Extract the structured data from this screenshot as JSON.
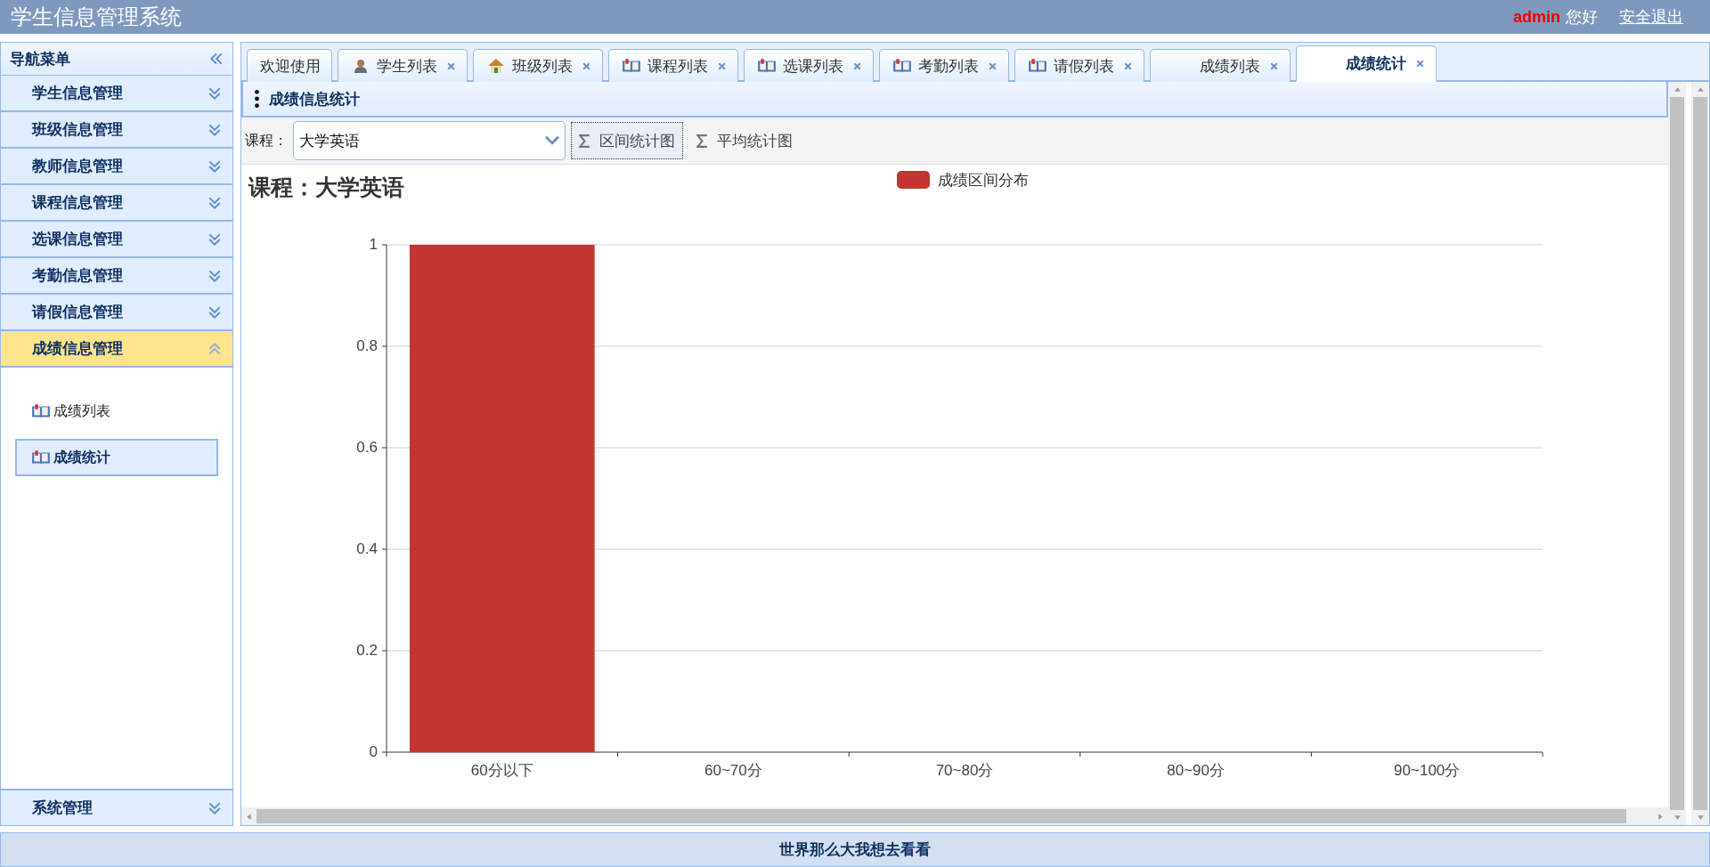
{
  "header": {
    "title": "学生信息管理系统",
    "user": "admin",
    "greeting": "您好",
    "logout": "安全退出"
  },
  "sidebar": {
    "title": "导航菜单",
    "items": [
      {
        "label": "学生信息管理",
        "expanded": false
      },
      {
        "label": "班级信息管理",
        "expanded": false
      },
      {
        "label": "教师信息管理",
        "expanded": false
      },
      {
        "label": "课程信息管理",
        "expanded": false
      },
      {
        "label": "选课信息管理",
        "expanded": false
      },
      {
        "label": "考勤信息管理",
        "expanded": false
      },
      {
        "label": "请假信息管理",
        "expanded": false
      },
      {
        "label": "成绩信息管理",
        "expanded": true,
        "children": [
          {
            "label": "成绩列表",
            "selected": false
          },
          {
            "label": "成绩统计",
            "selected": true
          }
        ]
      }
    ],
    "bottom_item": {
      "label": "系统管理",
      "expanded": false
    }
  },
  "tabs": [
    {
      "label": "欢迎使用",
      "kind": "plain",
      "closable": false,
      "selected": false
    },
    {
      "label": "学生列表",
      "kind": "person",
      "closable": true,
      "selected": false
    },
    {
      "label": "班级列表",
      "kind": "house",
      "closable": true,
      "selected": false
    },
    {
      "label": "课程列表",
      "kind": "book",
      "closable": true,
      "selected": false
    },
    {
      "label": "选课列表",
      "kind": "book",
      "closable": true,
      "selected": false
    },
    {
      "label": "考勤列表",
      "kind": "book",
      "closable": true,
      "selected": false
    },
    {
      "label": "请假列表",
      "kind": "book",
      "closable": true,
      "selected": false
    },
    {
      "label": "成绩列表",
      "kind": "spaced",
      "closable": true,
      "selected": false
    },
    {
      "label": "成绩统计",
      "kind": "spaced",
      "closable": true,
      "selected": true
    }
  ],
  "panel": {
    "title": "成绩信息统计"
  },
  "toolbar": {
    "course_label": "课程：",
    "course_value": "大学英语",
    "buttons": [
      {
        "label": "区间统计图",
        "focused": true
      },
      {
        "label": "平均统计图",
        "focused": false
      }
    ]
  },
  "chart": {
    "chart_data": {
      "type": "bar",
      "title": "课程：大学英语",
      "categories": [
        "60分以下",
        "60~70分",
        "70~80分",
        "80~90分",
        "90~100分"
      ],
      "series": [
        {
          "name": "成绩区间分布",
          "color": "#c23531",
          "values": [
            1,
            0,
            0,
            0,
            0
          ]
        }
      ],
      "ylim": [
        0,
        1
      ],
      "grid": true,
      "yticks": [
        0,
        0.2,
        0.4,
        0.6,
        0.8,
        1
      ]
    }
  },
  "footer": "世界那么大我想去看看"
}
